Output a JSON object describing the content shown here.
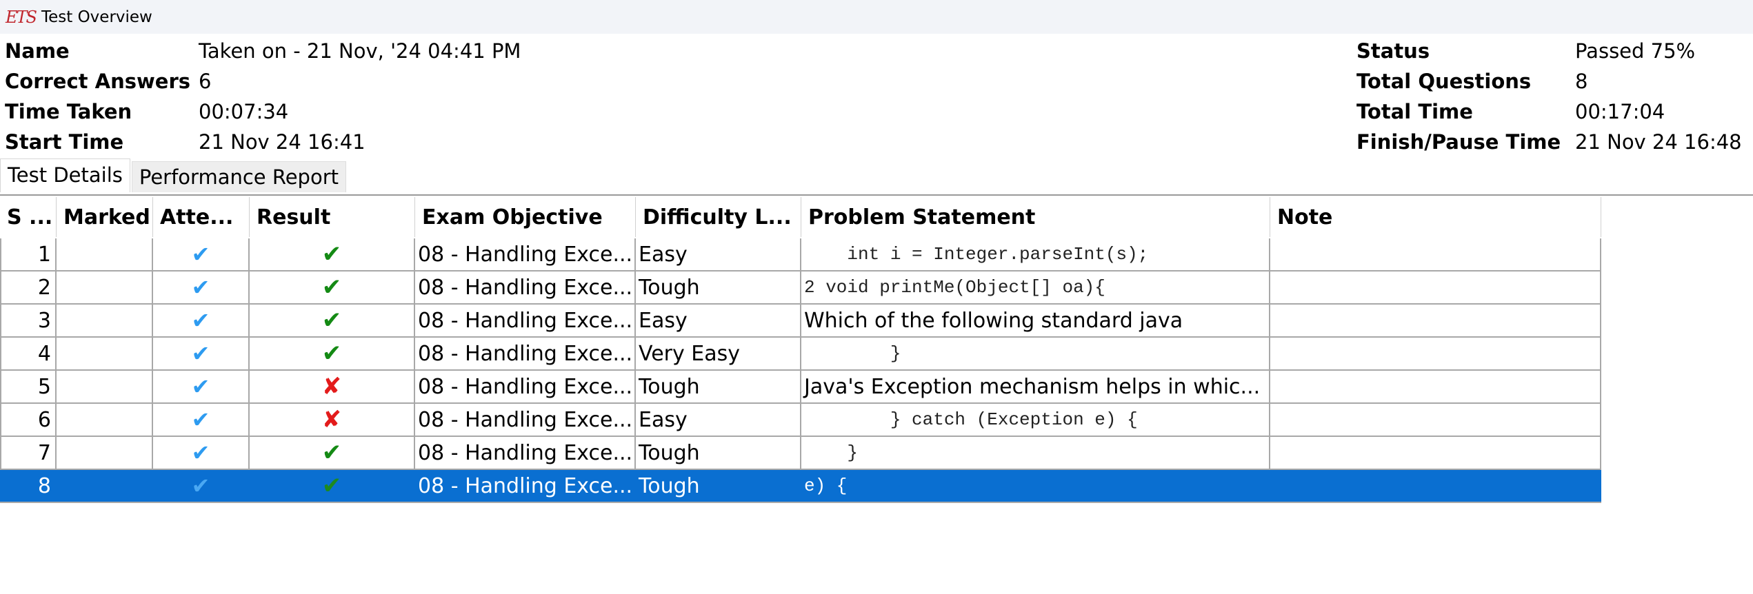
{
  "window": {
    "title": "Test Overview",
    "logo_text": "ETS"
  },
  "summary": {
    "name_label": "Name",
    "name_value": "Taken on - 21 Nov, '24 04:41 PM",
    "correct_label": "Correct Answers",
    "correct_value": "6",
    "time_taken_label": "Time Taken",
    "time_taken_value": "00:07:34",
    "start_label": "Start Time",
    "start_value": "21 Nov 24 16:41",
    "status_label": "Status",
    "status_value": "Passed 75%",
    "total_q_label": "Total Questions",
    "total_q_value": "8",
    "total_time_label": "Total Time",
    "total_time_value": "00:17:04",
    "finish_label": "Finish/Pause Time",
    "finish_value": "21 Nov 24 16:48"
  },
  "tabs": [
    {
      "label": "Test Details",
      "active": true
    },
    {
      "label": "Performance Report",
      "active": false
    }
  ],
  "table": {
    "columns": [
      "S ...",
      "Marked",
      "Atte...",
      "Result",
      "Exam Objective",
      "Difficulty L...",
      "Problem Statement",
      "Note"
    ],
    "rows": [
      {
        "sn": "1",
        "marked": "",
        "attempted": "✔",
        "result": "✔",
        "result_type": "correct",
        "objective": "08 - Handling Exce...",
        "difficulty": "Easy",
        "problem": "    int i = Integer.parseInt(s);",
        "problem_mono": true,
        "note": ""
      },
      {
        "sn": "2",
        "marked": "",
        "attempted": "✔",
        "result": "✔",
        "result_type": "correct",
        "objective": "08 - Handling Exce...",
        "difficulty": "Tough",
        "problem": "2 void printMe(Object[] oa){",
        "problem_mono": true,
        "note": ""
      },
      {
        "sn": "3",
        "marked": "",
        "attempted": "✔",
        "result": "✔",
        "result_type": "correct",
        "objective": "08 - Handling Exce...",
        "difficulty": "Easy",
        "problem": "Which of the following standard java",
        "problem_mono": false,
        "note": ""
      },
      {
        "sn": "4",
        "marked": "",
        "attempted": "✔",
        "result": "✔",
        "result_type": "correct",
        "objective": "08 - Handling Exce...",
        "difficulty": "Very Easy",
        "problem": "        }",
        "problem_mono": true,
        "note": ""
      },
      {
        "sn": "5",
        "marked": "",
        "attempted": "✔",
        "result": "✘",
        "result_type": "wrong",
        "objective": "08 - Handling Exce...",
        "difficulty": "Tough",
        "problem": "Java's Exception mechanism helps in whic...",
        "problem_mono": false,
        "note": ""
      },
      {
        "sn": "6",
        "marked": "",
        "attempted": "✔",
        "result": "✘",
        "result_type": "wrong",
        "objective": "08 - Handling Exce...",
        "difficulty": "Easy",
        "problem": "        } catch (Exception e) {",
        "problem_mono": true,
        "note": ""
      },
      {
        "sn": "7",
        "marked": "",
        "attempted": "✔",
        "result": "✔",
        "result_type": "correct",
        "objective": "08 - Handling Exce...",
        "difficulty": "Tough",
        "problem": "    }",
        "problem_mono": true,
        "note": ""
      },
      {
        "sn": "8",
        "marked": "",
        "attempted": "✔",
        "result": "✔",
        "result_type": "correct",
        "objective": "08 - Handling Exce...",
        "difficulty": "Tough",
        "problem": "e) {",
        "problem_mono": true,
        "note": "",
        "selected": true
      }
    ]
  },
  "colors": {
    "selection": "#0a6fd1",
    "check_blue": "#2d9bf0",
    "check_green": "#148a14",
    "cross_red": "#e31b1b"
  }
}
